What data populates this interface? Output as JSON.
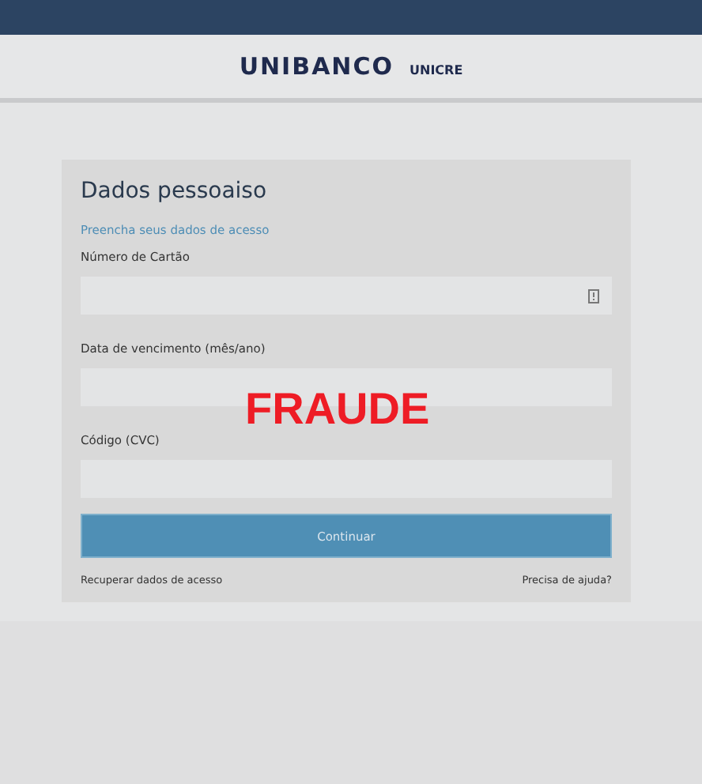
{
  "header": {
    "brand": "UNIBANCO",
    "partner": "UNICRE"
  },
  "form": {
    "title": "Dados pessoaiso",
    "subtitle": "Preencha seus dados de acesso",
    "fields": [
      {
        "label": "Número de Cartão",
        "kind": "icon"
      },
      {
        "label": "Data de vencimento (mês/ano)",
        "kind": "plain"
      },
      {
        "label": "Código (CVC)",
        "kind": "plain"
      }
    ],
    "submit": "Continuar",
    "links": [
      "Recuperar dados de acesso",
      "Precisa de ajuda?"
    ]
  },
  "overlay_label": "FRAUDE"
}
